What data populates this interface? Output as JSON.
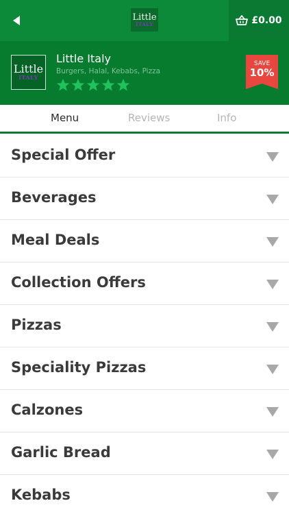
{
  "topbar": {
    "back_icon": "back-arrow-icon",
    "logo_text_1": "Little",
    "logo_text_2": "ITALY",
    "basket_icon": "basket-icon",
    "basket_total": "£0.00"
  },
  "restaurant": {
    "logo_text_1": "Little",
    "logo_text_2": "ITALY",
    "name": "Little Italy",
    "cuisines": "Burgers, Halal, Kebabs, Pizza",
    "rating": 5,
    "rating_max": 5,
    "save_label": "SAVE",
    "save_value": "10%"
  },
  "tabs": [
    {
      "label": "Menu",
      "active": true
    },
    {
      "label": "Reviews",
      "active": false
    },
    {
      "label": "Info",
      "active": false
    }
  ],
  "menu": [
    {
      "label": "Special Offer"
    },
    {
      "label": "Beverages"
    },
    {
      "label": "Meal Deals"
    },
    {
      "label": "Collection Offers"
    },
    {
      "label": "Pizzas"
    },
    {
      "label": "Speciality Pizzas"
    },
    {
      "label": "Calzones"
    },
    {
      "label": "Garlic Bread"
    },
    {
      "label": "Kebabs"
    }
  ],
  "colors": {
    "primary_green": "#0c8a3a",
    "header_green": "#077b2e",
    "star_green": "#21c25c",
    "badge_red": "#e8473f",
    "chevron_grey": "#a8a8a8"
  }
}
